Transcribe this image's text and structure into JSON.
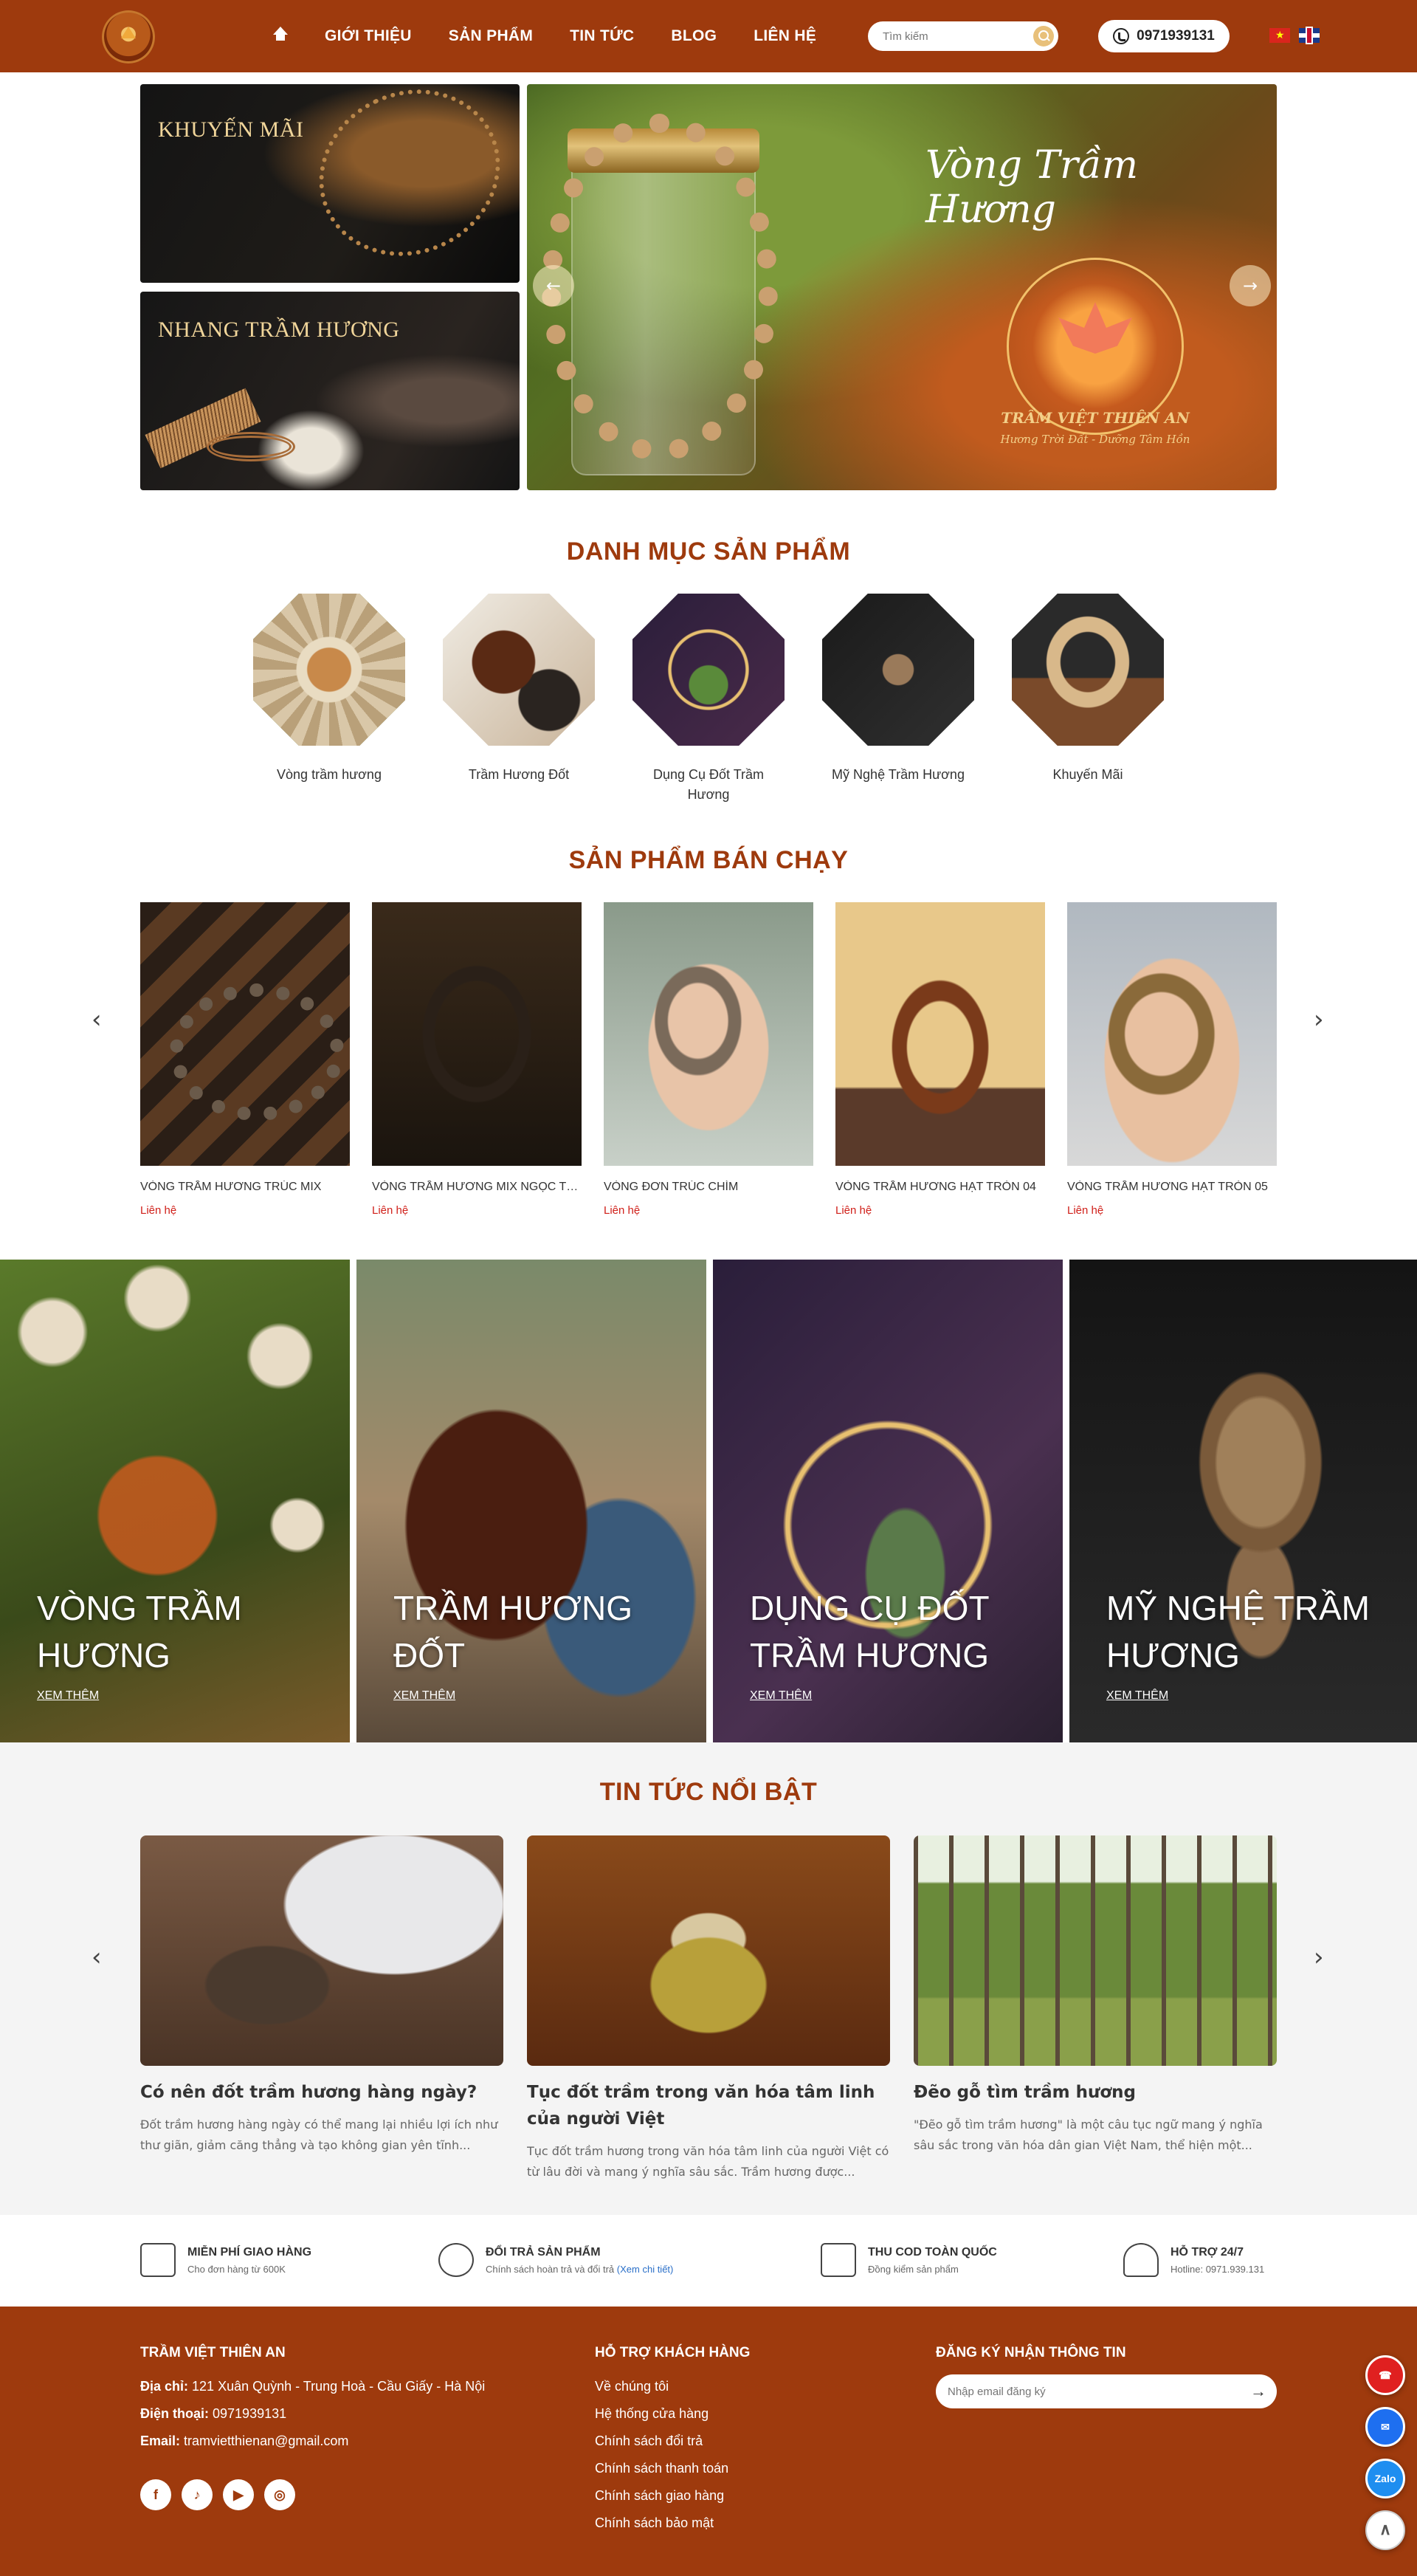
{
  "header": {
    "nav": [
      "GIỚI THIỆU",
      "SẢN PHẨM",
      "TIN TỨC",
      "BLOG",
      "LIÊN HỆ"
    ],
    "search_placeholder": "Tìm kiếm",
    "hotline": "0971939131",
    "icons": [
      "home-icon",
      "search-icon",
      "phone-icon",
      "flag-vn-icon",
      "flag-uk-icon"
    ]
  },
  "hero": {
    "promo_1": "KHUYẾN MÃI",
    "promo_2": "NHANG TRẦM HƯƠNG",
    "banner_title": "Vòng Trầm Hương",
    "banner_brand": "TRẦM VIỆT THIÊN AN",
    "banner_slogan": "Hương Trời Đất - Dưỡng Tâm Hồn",
    "prev": "←",
    "next": "→"
  },
  "categories": {
    "title": "DANH MỤC SẢN PHẨM",
    "items": [
      "Vòng trầm hương",
      "Trầm Hương Đốt",
      "Dụng Cụ Đốt Trầm Hương",
      "Mỹ Nghệ Trầm Hương",
      "Khuyến Mãi"
    ]
  },
  "best_sellers": {
    "title": "SẢN PHẨM BÁN CHẠY",
    "products": [
      {
        "name": "VÒNG TRẦM HƯƠNG TRÚC MIX",
        "price": "Liên hệ"
      },
      {
        "name": "VÒNG TRẦM HƯƠNG MIX NGỌC TRAI",
        "price": "Liên hệ"
      },
      {
        "name": "VÒNG ĐƠN TRÚC CHÌM",
        "price": "Liên hệ"
      },
      {
        "name": "VÒNG TRẦM HƯƠNG HẠT TRÒN 04",
        "price": "Liên hệ"
      },
      {
        "name": "VÒNG TRẦM HƯƠNG HẠT TRÒN 05",
        "price": "Liên hệ"
      }
    ],
    "prev": "‹",
    "next": "›"
  },
  "tiles": [
    {
      "title": "VÒNG TRẦM HƯƠNG",
      "more": "XEM THÊM"
    },
    {
      "title": "TRẦM HƯƠNG ĐỐT",
      "more": "XEM THÊM"
    },
    {
      "title": "DỤNG CỤ ĐỐT TRẦM HƯƠNG",
      "more": "XEM THÊM"
    },
    {
      "title": "MỸ NGHỆ TRẦM HƯƠNG",
      "more": "XEM THÊM"
    }
  ],
  "news": {
    "title": "TIN TỨC NỔI BẬT",
    "items": [
      {
        "title": "Có nên đốt trầm hương hàng ngày?",
        "excerpt": "Đốt trầm hương hàng ngày có thể mang lại nhiều lợi ích như thư giãn, giảm căng thẳng và tạo không gian yên tĩnh..."
      },
      {
        "title": "Tục đốt trầm trong văn hóa tâm linh của người Việt",
        "excerpt": "Tục đốt trầm hương trong văn hóa tâm linh của người Việt có từ lâu đời và mang ý nghĩa sâu sắc. Trầm hương được..."
      },
      {
        "title": "Đẽo gỗ tìm trầm hương",
        "excerpt": "\"Đẽo gỗ tìm trầm hương\" là một câu tục ngữ mang ý nghĩa sâu sắc trong văn hóa dân gian Việt Nam, thể hiện một..."
      }
    ],
    "prev": "‹",
    "next": "›"
  },
  "features": [
    {
      "title": "MIỄN PHÍ GIAO HÀNG",
      "desc": "Cho đơn hàng từ 600K"
    },
    {
      "title": "ĐỔI TRẢ SẢN PHẨM",
      "desc": "Chính sách hoàn trả và đổi trả",
      "link": "(Xem chi tiết)"
    },
    {
      "title": "THU COD TOÀN QUỐC",
      "desc": "Đồng kiểm sản phẩm"
    },
    {
      "title": "HỖ TRỢ 24/7",
      "desc": "Hotline: 0971.939.131"
    }
  ],
  "footer": {
    "company": "TRẦM VIỆT THIÊN AN",
    "address_label": "Địa chỉ:",
    "address": "121 Xuân Quỳnh - Trung Hoà - Cầu Giấy - Hà Nội",
    "phone_label": "Điện thoại:",
    "phone": "0971939131",
    "email_label": "Email:",
    "email": "tramvietthienan@gmail.com",
    "support_title": "HỖ TRỢ KHÁCH HÀNG",
    "support_links": [
      "Về chúng tôi",
      "Hệ thống cửa hàng",
      "Chính sách đổi trả",
      "Chính sách thanh toán",
      "Chính sách giao hàng",
      "Chính sách bảo mật"
    ],
    "newsletter_title": "ĐĂNG KÝ NHẬN THÔNG TIN",
    "newsletter_placeholder": "Nhập email đăng ký",
    "send": "→",
    "social": [
      "f",
      "♪",
      "▶",
      "◎"
    ]
  },
  "floating": {
    "zalo": "Zalo",
    "top": "∧"
  },
  "colors": {
    "brand": "#9e3a0d",
    "price": "#d0201a"
  }
}
